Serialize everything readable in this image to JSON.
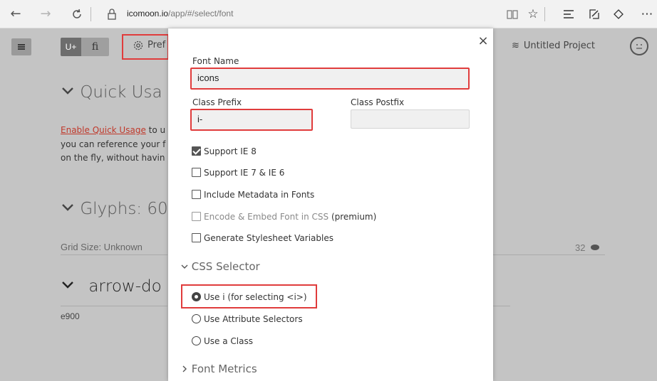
{
  "browser": {
    "url_domain": "icomoon.io",
    "url_path": "/app/#/select/font"
  },
  "header": {
    "seg_unicode": "U+",
    "seg_ligature": "fi",
    "prefs_label": "Pref",
    "project_label": "Untitled Project"
  },
  "background": {
    "quick_usage_title": "Quick Usa",
    "enable_link": "Enable Quick Usage",
    "quick_line1_suffix": " to u",
    "quick_line2": "you can reference your f",
    "quick_line3": "on the fly, without havin",
    "glyphs_title": "Glyphs: 60",
    "grid_size": "Grid Size: Unknown",
    "grid_number": "32",
    "glyph_name": "arrow-do",
    "glyph_code": "e900"
  },
  "modal": {
    "close": "×",
    "font_name_label": "Font Name",
    "font_name_value": "icons",
    "class_prefix_label": "Class Prefix",
    "class_prefix_value": "i-",
    "class_postfix_label": "Class Postfix",
    "class_postfix_value": "",
    "options": [
      {
        "label": "Support IE 8",
        "checked": true
      },
      {
        "label": "Support IE 7 & IE 6",
        "checked": false
      },
      {
        "label": "Include Metadata in Fonts",
        "checked": false
      },
      {
        "label": "Encode & Embed Font in CSS",
        "suffix": "(premium)",
        "checked": false
      },
      {
        "label": "Generate Stylesheet Variables",
        "checked": false
      }
    ],
    "css_selector_title": "CSS Selector",
    "radios": [
      {
        "label": "Use i (for selecting <i>)",
        "selected": true
      },
      {
        "label": "Use Attribute Selectors",
        "selected": false
      },
      {
        "label": "Use a Class",
        "selected": false
      }
    ],
    "font_metrics_title": "Font Metrics"
  },
  "colors": {
    "highlight": "#e03c3c",
    "link": "#c0392b",
    "overlay": "#c4c4c4"
  }
}
